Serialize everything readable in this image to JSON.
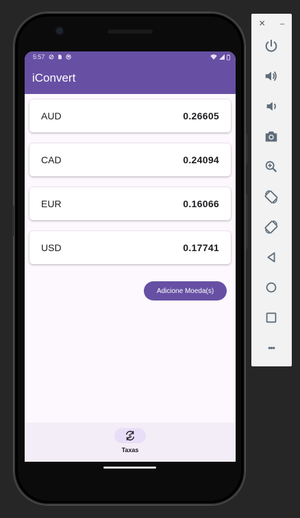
{
  "statusbar": {
    "time": "5:57"
  },
  "appbar": {
    "title": "iConvert"
  },
  "rates": [
    {
      "code": "AUD",
      "value": "0.26605"
    },
    {
      "code": "CAD",
      "value": "0.24094"
    },
    {
      "code": "EUR",
      "value": "0.16066"
    },
    {
      "code": "USD",
      "value": "0.17741"
    }
  ],
  "add_button": {
    "label": "Adicione Moeda(s)"
  },
  "bottom_nav": {
    "items": [
      {
        "label": "Taxas",
        "icon": "currency-exchange-icon"
      }
    ]
  },
  "emulator": {
    "close_glyph": "✕",
    "minimize_glyph": "–",
    "more_glyph": "•••",
    "controls": [
      "power",
      "volume-up",
      "volume-down",
      "screenshot",
      "zoom",
      "rotate-left",
      "rotate-right",
      "back",
      "home",
      "overview",
      "more"
    ]
  },
  "colors": {
    "primary": "#6750a4",
    "surface": "#fdf8fd",
    "nav_surface": "#f3edf7",
    "nav_indicator": "#e8def8",
    "emulator_bg": "#262626"
  }
}
